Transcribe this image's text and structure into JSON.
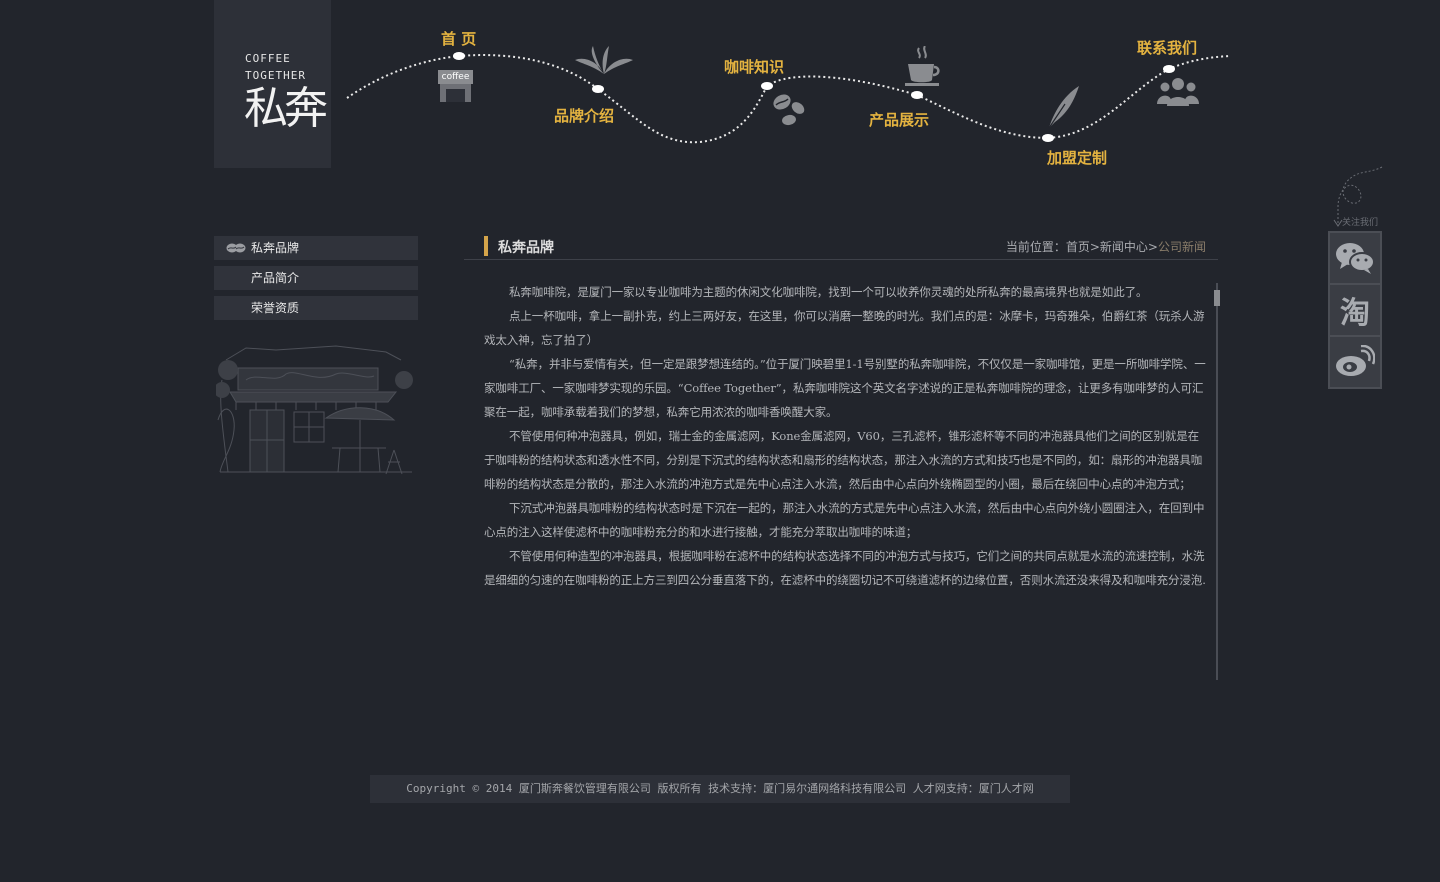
{
  "logo": {
    "en_line1": "COFFEE",
    "en_line2": "TOGETHER",
    "cn": "私奔"
  },
  "nav": {
    "items": [
      {
        "label": "首 页"
      },
      {
        "label": "品牌介绍"
      },
      {
        "label": "咖啡知识"
      },
      {
        "label": "产品展示"
      },
      {
        "label": "加盟定制"
      },
      {
        "label": "联系我们"
      }
    ],
    "coffee_sign_text": "coffee"
  },
  "follow": {
    "label": "关注我们",
    "icons": [
      "wechat-icon",
      "taobao-icon",
      "weibo-icon"
    ],
    "taobao_glyph": "淘"
  },
  "sidebar": {
    "items": [
      {
        "label": "私奔品牌",
        "active": true
      },
      {
        "label": "产品简介"
      },
      {
        "label": "荣誉资质"
      }
    ]
  },
  "section": {
    "title": "私奔品牌"
  },
  "breadcrumb": {
    "prefix": "当前位置：",
    "items": [
      "首页",
      "新闻中心",
      "公司新闻"
    ],
    "separator": ">"
  },
  "article": {
    "paragraphs": [
      "私奔咖啡院，是厦门一家以专业咖啡为主题的休闲文化咖啡院，找到一个可以收养你灵魂的处所私奔的最高境界也就是如此了。",
      "点上一杯咖啡，拿上一副扑克，约上三两好友，在这里，你可以消磨一整晚的时光。我们点的是：冰摩卡，玛奇雅朵，伯爵红茶（玩杀人游戏太入神，忘了拍了）",
      "“私奔，并非与爱情有关，但一定是跟梦想连结的。”位于厦门映碧里1-1号别墅的私奔咖啡院，不仅仅是一家咖啡馆，更是一所咖啡学院、一家咖啡工厂、一家咖啡梦实现的乐园。“Coffee Together”，私奔咖啡院这个英文名字述说的正是私奔咖啡院的理念，让更多有咖啡梦的人可汇聚在一起，咖啡承载着我们的梦想，私奔它用浓浓的咖啡香唤醒大家。",
      "不管使用何种冲泡器具，例如，瑞士金的金属滤网，Kone金属滤网，V60，三孔滤杯，锥形滤杯等不同的冲泡器具他们之间的区别就是在于咖啡粉的结构状态和透水性不同，分别是下沉式的结构状态和扇形的结构状态，那注入水流的方式和技巧也是不同的，如：扇形的冲泡器具咖啡粉的结构状态是分散的，那注入水流的冲泡方式是先中心点注入水流，然后由中心点向外绕椭圆型的小圈，最后在绕回中心点的冲泡方式；",
      "下沉式冲泡器具咖啡粉的结构状态时是下沉在一起的，那注入水流的方式是先中心点注入水流，然后由中心点向外绕小圆圈注入，在回到中心点的注入这样使滤杯中的咖啡粉充分的和水进行接触，才能充分萃取出咖啡的味道；",
      "不管使用何种造型的冲泡器具，根据咖啡粉在滤杯中的结构状态选择不同的冲泡方式与技巧，它们之间的共同点就是水流的流速控制，水洗是细细的匀速的在咖啡粉的正上方三到四公分垂直落下的，在滤杯中的绕圈切记不可绕道滤杯的边缘位置，否则水流还没来得及和咖啡充分浸泡."
    ]
  },
  "footer": {
    "text": "Copyright © 2014 厦门斯奔餐饮管理有限公司 版权所有 技术支持：厦门易尔通网络科技有限公司 人才网支持：厦门人才网"
  },
  "colors": {
    "background": "#22252c",
    "accent": "#e4b340",
    "panel": "#2d3038"
  }
}
